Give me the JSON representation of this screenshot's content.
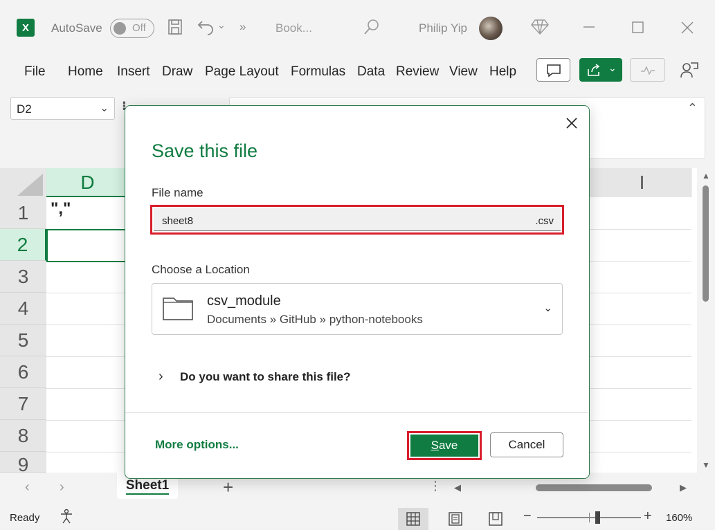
{
  "titlebar": {
    "autosave_label": "AutoSave",
    "autosave_state": "Off",
    "book_name": "Book...",
    "user_name": "Philip Yip",
    "app_logo": "X"
  },
  "ribbon": {
    "tabs": [
      "File",
      "Home",
      "Insert",
      "Draw",
      "Page Layout",
      "Formulas",
      "Data",
      "Review",
      "View",
      "Help"
    ]
  },
  "formula_bar": {
    "name_box": "D2"
  },
  "grid": {
    "columns": [
      "D",
      "I"
    ],
    "rows": [
      "1",
      "2",
      "3",
      "4",
      "5",
      "6",
      "7",
      "8",
      "9"
    ],
    "selected_cell": "D2",
    "cell_D1": "\",\""
  },
  "sheets": {
    "active": "Sheet1"
  },
  "status": {
    "ready": "Ready",
    "zoom": "160%"
  },
  "dialog": {
    "title": "Save this file",
    "file_name_label": "File name",
    "file_name_value": "sheet8",
    "file_extension": ".csv",
    "location_label": "Choose a Location",
    "location_name": "csv_module",
    "location_path": "Documents » GitHub » python-notebooks",
    "share_prompt": "Do you want to share this file?",
    "more_options": "More options...",
    "save_label_first": "S",
    "save_label_rest": "ave",
    "cancel_label": "Cancel"
  },
  "colors": {
    "accent": "#107c41",
    "highlight": "#d81e2c"
  }
}
